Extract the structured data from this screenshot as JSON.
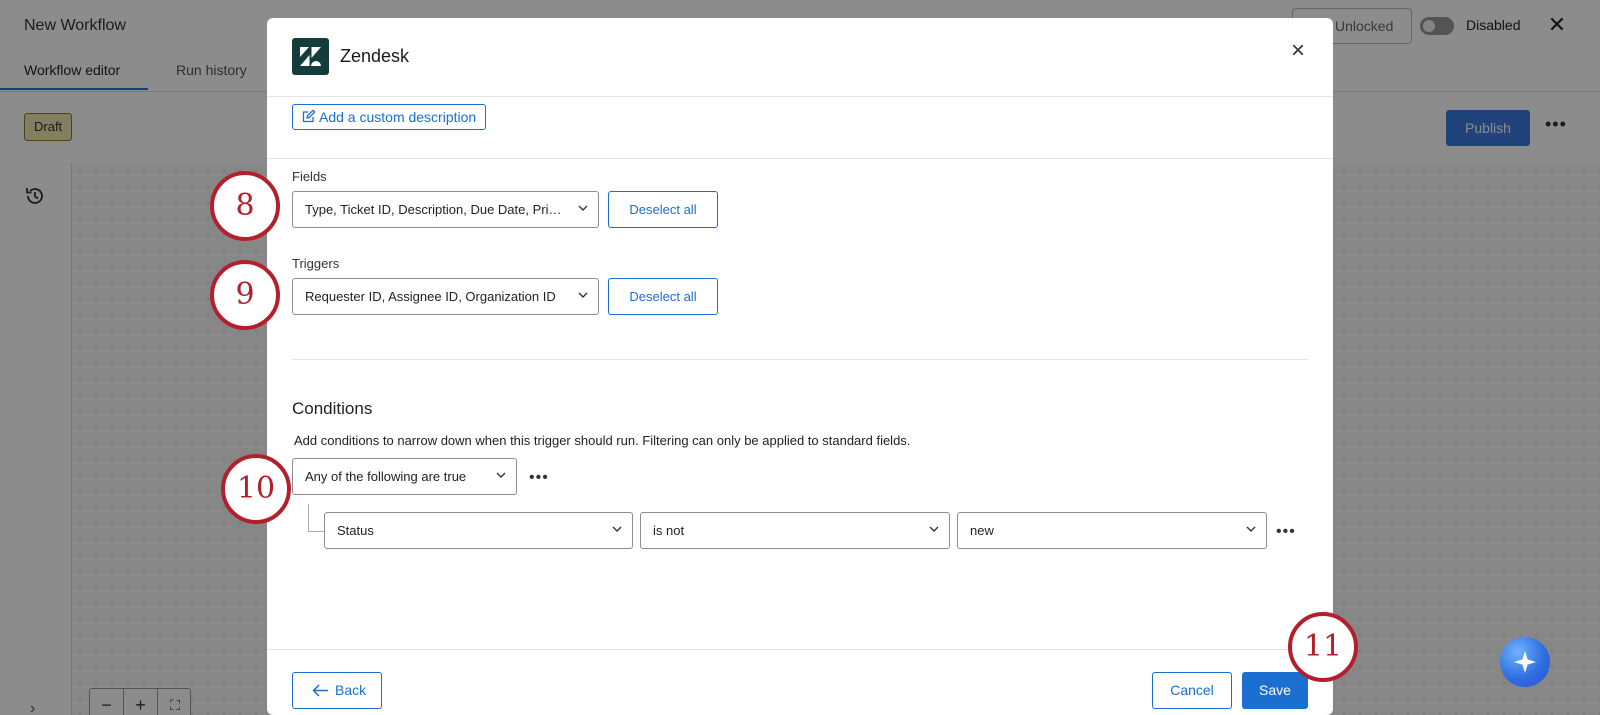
{
  "app": {
    "title": "New Workflow",
    "tabs": [
      {
        "label": "Workflow editor"
      },
      {
        "label": "Run history"
      }
    ],
    "status_badge": "Draft",
    "lock_button": "Unlocked",
    "toggle_label": "Disabled",
    "publish_label": "Publish"
  },
  "modal": {
    "title": "Zendesk",
    "custom_description_label": "Add a custom description",
    "fields": {
      "label": "Fields",
      "value": "Type, Ticket ID, Description, Due Date, Priority",
      "deselect_label": "Deselect all"
    },
    "triggers": {
      "label": "Triggers",
      "value": "Requester ID, Assignee ID, Organization ID",
      "deselect_label": "Deselect all"
    },
    "conditions": {
      "title": "Conditions",
      "description": "Add conditions to narrow down when this trigger should run. Filtering can only be applied to standard fields.",
      "group_operator": "Any of the following are true",
      "rule": {
        "field": "Status",
        "operator": "is not",
        "value": "new"
      }
    },
    "footer": {
      "back_label": "Back",
      "cancel_label": "Cancel",
      "save_label": "Save"
    }
  },
  "callouts": [
    "8",
    "9",
    "10",
    "11"
  ],
  "colors": {
    "accent": "#1a6fd1",
    "callout": "#b3202c",
    "zendesk_logo": "#133c3b",
    "draft_badge": "#f3e7b2"
  }
}
